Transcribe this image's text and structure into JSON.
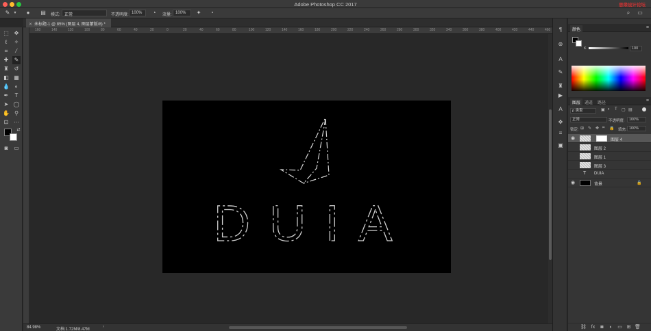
{
  "app": {
    "title": "Adobe Photoshop CC 2017",
    "watermark": "思缘设计论坛"
  },
  "options_bar": {
    "mode_label": "模式:",
    "mode_value": "正常",
    "opacity_label": "不透明度:",
    "opacity_value": "100%",
    "flow_label": "流量:",
    "flow_value": "100%"
  },
  "document": {
    "tab_label": "未标题-1 @ 85% (图层 4, 图层蒙版/8) *",
    "zoom": "84.98%",
    "doc_info": "文档:1.72M/8.47M",
    "ruler_h_labels": [
      "160",
      "140",
      "120",
      "100",
      "80",
      "60",
      "40",
      "20",
      "0",
      "20",
      "40",
      "60",
      "80",
      "100",
      "120",
      "140",
      "160",
      "180",
      "200",
      "220",
      "240",
      "260",
      "280",
      "300",
      "320",
      "340",
      "360",
      "380",
      "400",
      "420",
      "440",
      "460"
    ],
    "canvas_text": "DUIA"
  },
  "color_panel": {
    "tab": "颜色",
    "k_label": "K",
    "k_value": "100"
  },
  "layers_panel": {
    "tabs": [
      "图层",
      "通道",
      "路径"
    ],
    "filter_kind": "ρ 类型",
    "blend_mode": "正常",
    "opacity_label": "不透明度:",
    "opacity_value": "100%",
    "lock_label": "锁定:",
    "fill_label": "填充:",
    "fill_value": "100%",
    "layers": [
      {
        "name": "图层 4",
        "visible": true,
        "selected": true
      },
      {
        "name": "图层 2",
        "visible": false,
        "selected": false
      },
      {
        "name": "图层 1",
        "visible": false,
        "selected": false
      },
      {
        "name": "图层 3",
        "visible": false,
        "selected": false
      },
      {
        "name": "DUIA",
        "visible": false,
        "selected": false
      },
      {
        "name": "背景",
        "visible": true,
        "selected": false
      }
    ]
  },
  "colors": {
    "accent_selected_layer": "#575757",
    "canvas_bg": "#000000"
  }
}
